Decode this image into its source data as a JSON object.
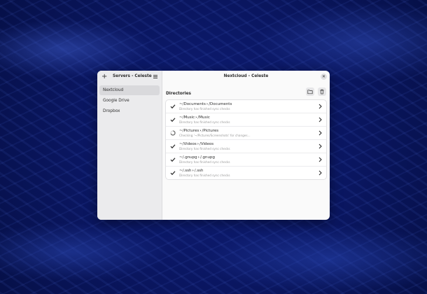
{
  "sidebar": {
    "add_icon": "plus-icon",
    "title": "Servers - Celeste",
    "menu_icon": "hamburger-menu-icon",
    "servers": [
      {
        "label": "Nextcloud",
        "selected": true
      },
      {
        "label": "Google Drive",
        "selected": false
      },
      {
        "label": "Dropbox",
        "selected": false
      }
    ]
  },
  "main": {
    "title": "Nextcloud - Celeste",
    "close_icon": "close-icon",
    "section_label": "Directories",
    "add_folder_icon": "folder-add-icon",
    "delete_icon": "trash-icon",
    "directories": [
      {
        "local": "~/Documents",
        "remote": "/Documents",
        "status": "Directory has finished sync checks",
        "state": "done"
      },
      {
        "local": "~/Music",
        "remote": "/Music",
        "status": "Directory has finished sync checks",
        "state": "done"
      },
      {
        "local": "~/Pictures",
        "remote": "/Pictures",
        "status": "Checking '~/Pictures/Screenshots' for changes...",
        "state": "syncing"
      },
      {
        "local": "~/Videos",
        "remote": "/Videos",
        "status": "Directory has finished sync checks",
        "state": "done"
      },
      {
        "local": "~/.gnupg",
        "remote": "/.gnupg",
        "status": "Directory has finished sync checks",
        "state": "done"
      },
      {
        "local": "~/.ssh",
        "remote": "/.ssh",
        "status": "Directory has finished sync checks",
        "state": "done"
      }
    ]
  },
  "colors": {
    "accent_text": "#2e2e2e",
    "sidebar_bg": "#ebebed",
    "selected_bg": "#d9d9dc",
    "desktop_bg": "#0a1660"
  }
}
